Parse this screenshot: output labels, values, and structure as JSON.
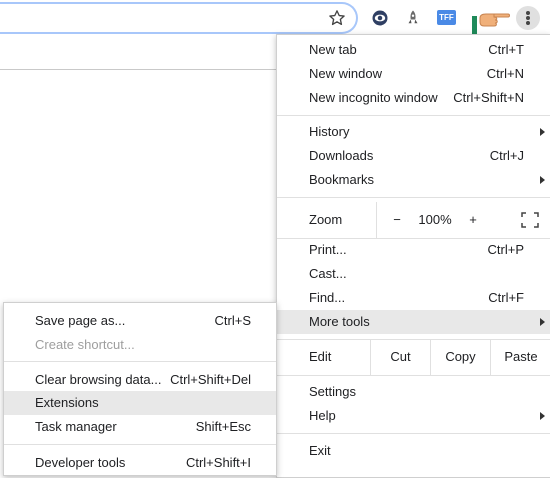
{
  "toolbar": {
    "extensions": [
      "bookmark-star-icon",
      "eye-extension-icon",
      "rocket-extension-icon",
      "tff-extension-icon",
      "hand-pointer-icon",
      "menu-dots-icon"
    ],
    "tff_label": "TFF"
  },
  "main_menu": {
    "items": [
      {
        "label": "New tab",
        "shortcut": "Ctrl+T"
      },
      {
        "label": "New window",
        "shortcut": "Ctrl+N"
      },
      {
        "label": "New incognito window",
        "shortcut": "Ctrl+Shift+N"
      },
      {
        "label": "History",
        "shortcut": ""
      },
      {
        "label": "Downloads",
        "shortcut": "Ctrl+J"
      },
      {
        "label": "Bookmarks",
        "shortcut": ""
      },
      {
        "label": "Print...",
        "shortcut": "Ctrl+P"
      },
      {
        "label": "Cast...",
        "shortcut": ""
      },
      {
        "label": "Find...",
        "shortcut": "Ctrl+F"
      },
      {
        "label": "More tools",
        "shortcut": ""
      },
      {
        "label": "Settings",
        "shortcut": ""
      },
      {
        "label": "Help",
        "shortcut": ""
      },
      {
        "label": "Exit",
        "shortcut": ""
      }
    ],
    "zoom": {
      "label": "Zoom",
      "minus": "−",
      "value": "100%",
      "plus": "+"
    },
    "edit": {
      "label": "Edit",
      "cut": "Cut",
      "copy": "Copy",
      "paste": "Paste"
    }
  },
  "sub_menu": {
    "items": [
      {
        "label": "Save page as...",
        "shortcut": "Ctrl+S"
      },
      {
        "label": "Create shortcut...",
        "shortcut": ""
      },
      {
        "label": "Clear browsing data...",
        "shortcut": "Ctrl+Shift+Del"
      },
      {
        "label": "Extensions",
        "shortcut": ""
      },
      {
        "label": "Task manager",
        "shortcut": "Shift+Esc"
      },
      {
        "label": "Developer tools",
        "shortcut": "Ctrl+Shift+I"
      }
    ]
  },
  "colors": {
    "highlight": "#e8e8e8",
    "disabled": "#9e9e9e",
    "omnibox_border": "#a8c7fa"
  }
}
